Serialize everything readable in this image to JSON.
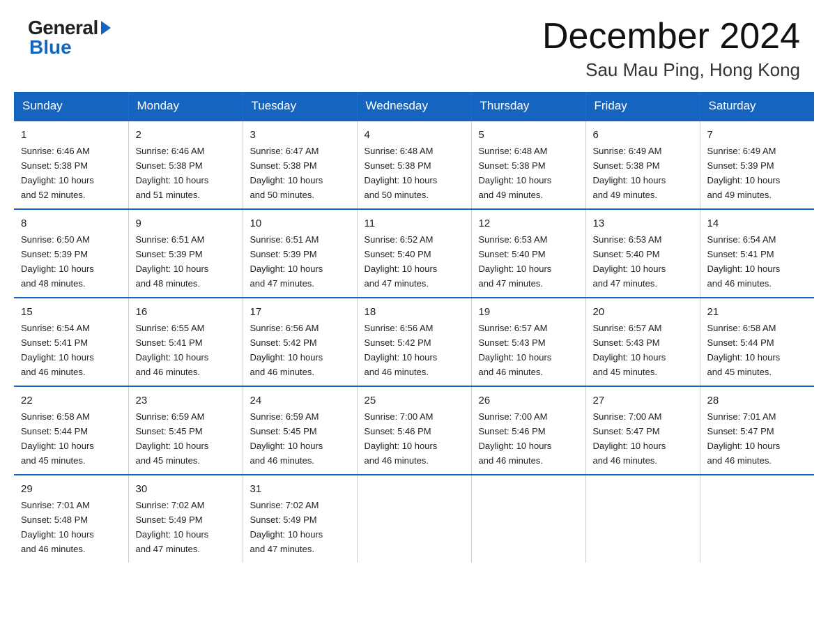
{
  "logo": {
    "general": "General",
    "blue": "Blue"
  },
  "title": "December 2024",
  "subtitle": "Sau Mau Ping, Hong Kong",
  "days": [
    "Sunday",
    "Monday",
    "Tuesday",
    "Wednesday",
    "Thursday",
    "Friday",
    "Saturday"
  ],
  "weeks": [
    [
      {
        "num": "1",
        "sunrise": "6:46 AM",
        "sunset": "5:38 PM",
        "daylight": "10 hours and 52 minutes."
      },
      {
        "num": "2",
        "sunrise": "6:46 AM",
        "sunset": "5:38 PM",
        "daylight": "10 hours and 51 minutes."
      },
      {
        "num": "3",
        "sunrise": "6:47 AM",
        "sunset": "5:38 PM",
        "daylight": "10 hours and 50 minutes."
      },
      {
        "num": "4",
        "sunrise": "6:48 AM",
        "sunset": "5:38 PM",
        "daylight": "10 hours and 50 minutes."
      },
      {
        "num": "5",
        "sunrise": "6:48 AM",
        "sunset": "5:38 PM",
        "daylight": "10 hours and 49 minutes."
      },
      {
        "num": "6",
        "sunrise": "6:49 AM",
        "sunset": "5:38 PM",
        "daylight": "10 hours and 49 minutes."
      },
      {
        "num": "7",
        "sunrise": "6:49 AM",
        "sunset": "5:39 PM",
        "daylight": "10 hours and 49 minutes."
      }
    ],
    [
      {
        "num": "8",
        "sunrise": "6:50 AM",
        "sunset": "5:39 PM",
        "daylight": "10 hours and 48 minutes."
      },
      {
        "num": "9",
        "sunrise": "6:51 AM",
        "sunset": "5:39 PM",
        "daylight": "10 hours and 48 minutes."
      },
      {
        "num": "10",
        "sunrise": "6:51 AM",
        "sunset": "5:39 PM",
        "daylight": "10 hours and 47 minutes."
      },
      {
        "num": "11",
        "sunrise": "6:52 AM",
        "sunset": "5:40 PM",
        "daylight": "10 hours and 47 minutes."
      },
      {
        "num": "12",
        "sunrise": "6:53 AM",
        "sunset": "5:40 PM",
        "daylight": "10 hours and 47 minutes."
      },
      {
        "num": "13",
        "sunrise": "6:53 AM",
        "sunset": "5:40 PM",
        "daylight": "10 hours and 47 minutes."
      },
      {
        "num": "14",
        "sunrise": "6:54 AM",
        "sunset": "5:41 PM",
        "daylight": "10 hours and 46 minutes."
      }
    ],
    [
      {
        "num": "15",
        "sunrise": "6:54 AM",
        "sunset": "5:41 PM",
        "daylight": "10 hours and 46 minutes."
      },
      {
        "num": "16",
        "sunrise": "6:55 AM",
        "sunset": "5:41 PM",
        "daylight": "10 hours and 46 minutes."
      },
      {
        "num": "17",
        "sunrise": "6:56 AM",
        "sunset": "5:42 PM",
        "daylight": "10 hours and 46 minutes."
      },
      {
        "num": "18",
        "sunrise": "6:56 AM",
        "sunset": "5:42 PM",
        "daylight": "10 hours and 46 minutes."
      },
      {
        "num": "19",
        "sunrise": "6:57 AM",
        "sunset": "5:43 PM",
        "daylight": "10 hours and 46 minutes."
      },
      {
        "num": "20",
        "sunrise": "6:57 AM",
        "sunset": "5:43 PM",
        "daylight": "10 hours and 45 minutes."
      },
      {
        "num": "21",
        "sunrise": "6:58 AM",
        "sunset": "5:44 PM",
        "daylight": "10 hours and 45 minutes."
      }
    ],
    [
      {
        "num": "22",
        "sunrise": "6:58 AM",
        "sunset": "5:44 PM",
        "daylight": "10 hours and 45 minutes."
      },
      {
        "num": "23",
        "sunrise": "6:59 AM",
        "sunset": "5:45 PM",
        "daylight": "10 hours and 45 minutes."
      },
      {
        "num": "24",
        "sunrise": "6:59 AM",
        "sunset": "5:45 PM",
        "daylight": "10 hours and 46 minutes."
      },
      {
        "num": "25",
        "sunrise": "7:00 AM",
        "sunset": "5:46 PM",
        "daylight": "10 hours and 46 minutes."
      },
      {
        "num": "26",
        "sunrise": "7:00 AM",
        "sunset": "5:46 PM",
        "daylight": "10 hours and 46 minutes."
      },
      {
        "num": "27",
        "sunrise": "7:00 AM",
        "sunset": "5:47 PM",
        "daylight": "10 hours and 46 minutes."
      },
      {
        "num": "28",
        "sunrise": "7:01 AM",
        "sunset": "5:47 PM",
        "daylight": "10 hours and 46 minutes."
      }
    ],
    [
      {
        "num": "29",
        "sunrise": "7:01 AM",
        "sunset": "5:48 PM",
        "daylight": "10 hours and 46 minutes."
      },
      {
        "num": "30",
        "sunrise": "7:02 AM",
        "sunset": "5:49 PM",
        "daylight": "10 hours and 47 minutes."
      },
      {
        "num": "31",
        "sunrise": "7:02 AM",
        "sunset": "5:49 PM",
        "daylight": "10 hours and 47 minutes."
      },
      null,
      null,
      null,
      null
    ]
  ],
  "labels": {
    "sunrise": "Sunrise:",
    "sunset": "Sunset:",
    "daylight": "Daylight:"
  }
}
